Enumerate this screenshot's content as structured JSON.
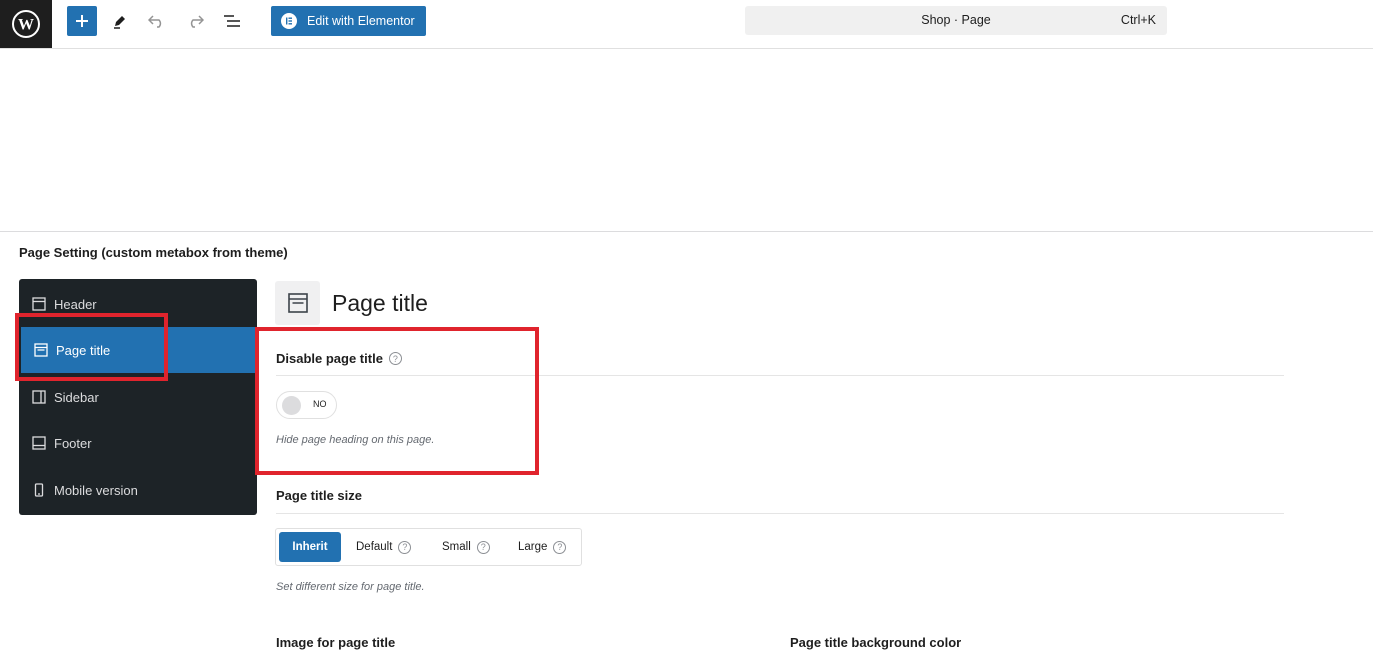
{
  "toolbar": {
    "add_label": "+",
    "elementor_label": "Edit with Elementor",
    "command_title": "Shop · Page",
    "command_shortcut": "Ctrl+K",
    "accent_color": "#2271b1"
  },
  "metabox": {
    "title": "Page Setting (custom metabox from theme)"
  },
  "sidebar": {
    "items": [
      {
        "label": "Header",
        "icon": "layout-header-icon",
        "active": false
      },
      {
        "label": "Page title",
        "icon": "window-icon",
        "active": true
      },
      {
        "label": "Sidebar",
        "icon": "sidebar-icon",
        "active": false
      },
      {
        "label": "Footer",
        "icon": "layout-footer-icon",
        "active": false
      },
      {
        "label": "Mobile version",
        "icon": "mobile-icon",
        "active": false
      }
    ]
  },
  "panel": {
    "heading": "Page title",
    "disable_title": {
      "label": "Disable page title",
      "help": "?",
      "toggle_value": "NO",
      "description": "Hide page heading on this page."
    },
    "title_size": {
      "label": "Page title size",
      "options": [
        {
          "label": "Inherit",
          "active": true,
          "help": ""
        },
        {
          "label": "Default",
          "active": false,
          "help": "?"
        },
        {
          "label": "Small",
          "active": false,
          "help": "?"
        },
        {
          "label": "Large",
          "active": false,
          "help": "?"
        }
      ],
      "description": "Set different size for page title."
    },
    "image_label": "Image for page title",
    "bg_color_label": "Page title background color"
  },
  "highlight_color": "#e0242d"
}
